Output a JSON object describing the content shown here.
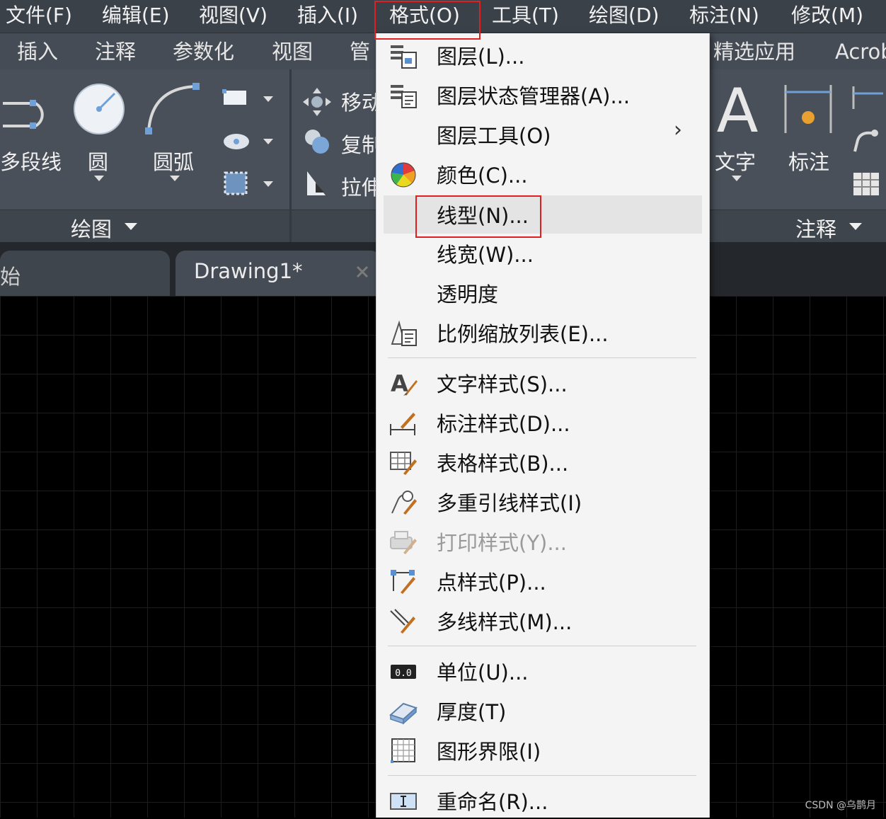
{
  "menubar": {
    "items": [
      "文件(F)",
      "编辑(E)",
      "视图(V)",
      "插入(I)",
      "格式(O)",
      "工具(T)",
      "绘图(D)",
      "标注(N)",
      "修改(M)"
    ]
  },
  "ribbon_tabs": {
    "items": [
      "插入",
      "注释",
      "参数化",
      "视图",
      "管",
      "精选应用",
      "Acrob"
    ]
  },
  "ribbon": {
    "draw_tools": {
      "polyline": "多段线",
      "circle": "圆",
      "arc": "圆弧"
    },
    "modify_tools": {
      "move": "移动",
      "copy": "复制",
      "stretch": "拉伸"
    },
    "annot_tools": {
      "text": "文字",
      "dimension": "标注"
    },
    "panels": {
      "draw": "绘图",
      "annotation": "注释"
    },
    "accent_color": "#6fa0d8"
  },
  "doc_tabs": {
    "start": "始",
    "drawing": "Drawing1*"
  },
  "format_menu": {
    "items": [
      {
        "label": "图层(L)...",
        "icon": "layer-icon"
      },
      {
        "label": "图层状态管理器(A)...",
        "icon": "layer-state-icon"
      },
      {
        "label": "图层工具(O)",
        "icon": "",
        "submenu": true
      },
      {
        "label": "颜色(C)...",
        "icon": "color-wheel-icon"
      },
      {
        "label": "线型(N)...",
        "icon": "",
        "highlighted": true
      },
      {
        "label": "线宽(W)...",
        "icon": ""
      },
      {
        "label": "透明度",
        "icon": ""
      },
      {
        "label": "比例缩放列表(E)...",
        "icon": "scale-list-icon"
      },
      {
        "label": "文字样式(S)...",
        "icon": "text-style-icon"
      },
      {
        "label": "标注样式(D)...",
        "icon": "dim-style-icon"
      },
      {
        "label": "表格样式(B)...",
        "icon": "table-style-icon"
      },
      {
        "label": "多重引线样式(I)",
        "icon": "mleader-style-icon"
      },
      {
        "label": "打印样式(Y)...",
        "icon": "plot-style-icon",
        "disabled": true
      },
      {
        "label": "点样式(P)...",
        "icon": "point-style-icon"
      },
      {
        "label": "多线样式(M)...",
        "icon": "mline-style-icon"
      },
      {
        "label": "单位(U)...",
        "icon": "units-icon"
      },
      {
        "label": "厚度(T)",
        "icon": "thickness-icon"
      },
      {
        "label": "图形界限(I)",
        "icon": "limits-icon"
      },
      {
        "label": "重命名(R)...",
        "icon": "rename-icon"
      }
    ],
    "submenu_arrow": "›",
    "units_icon_text": "0.0"
  },
  "highlight_color": "#e02020",
  "watermark": "CSDN @乌鹊月"
}
